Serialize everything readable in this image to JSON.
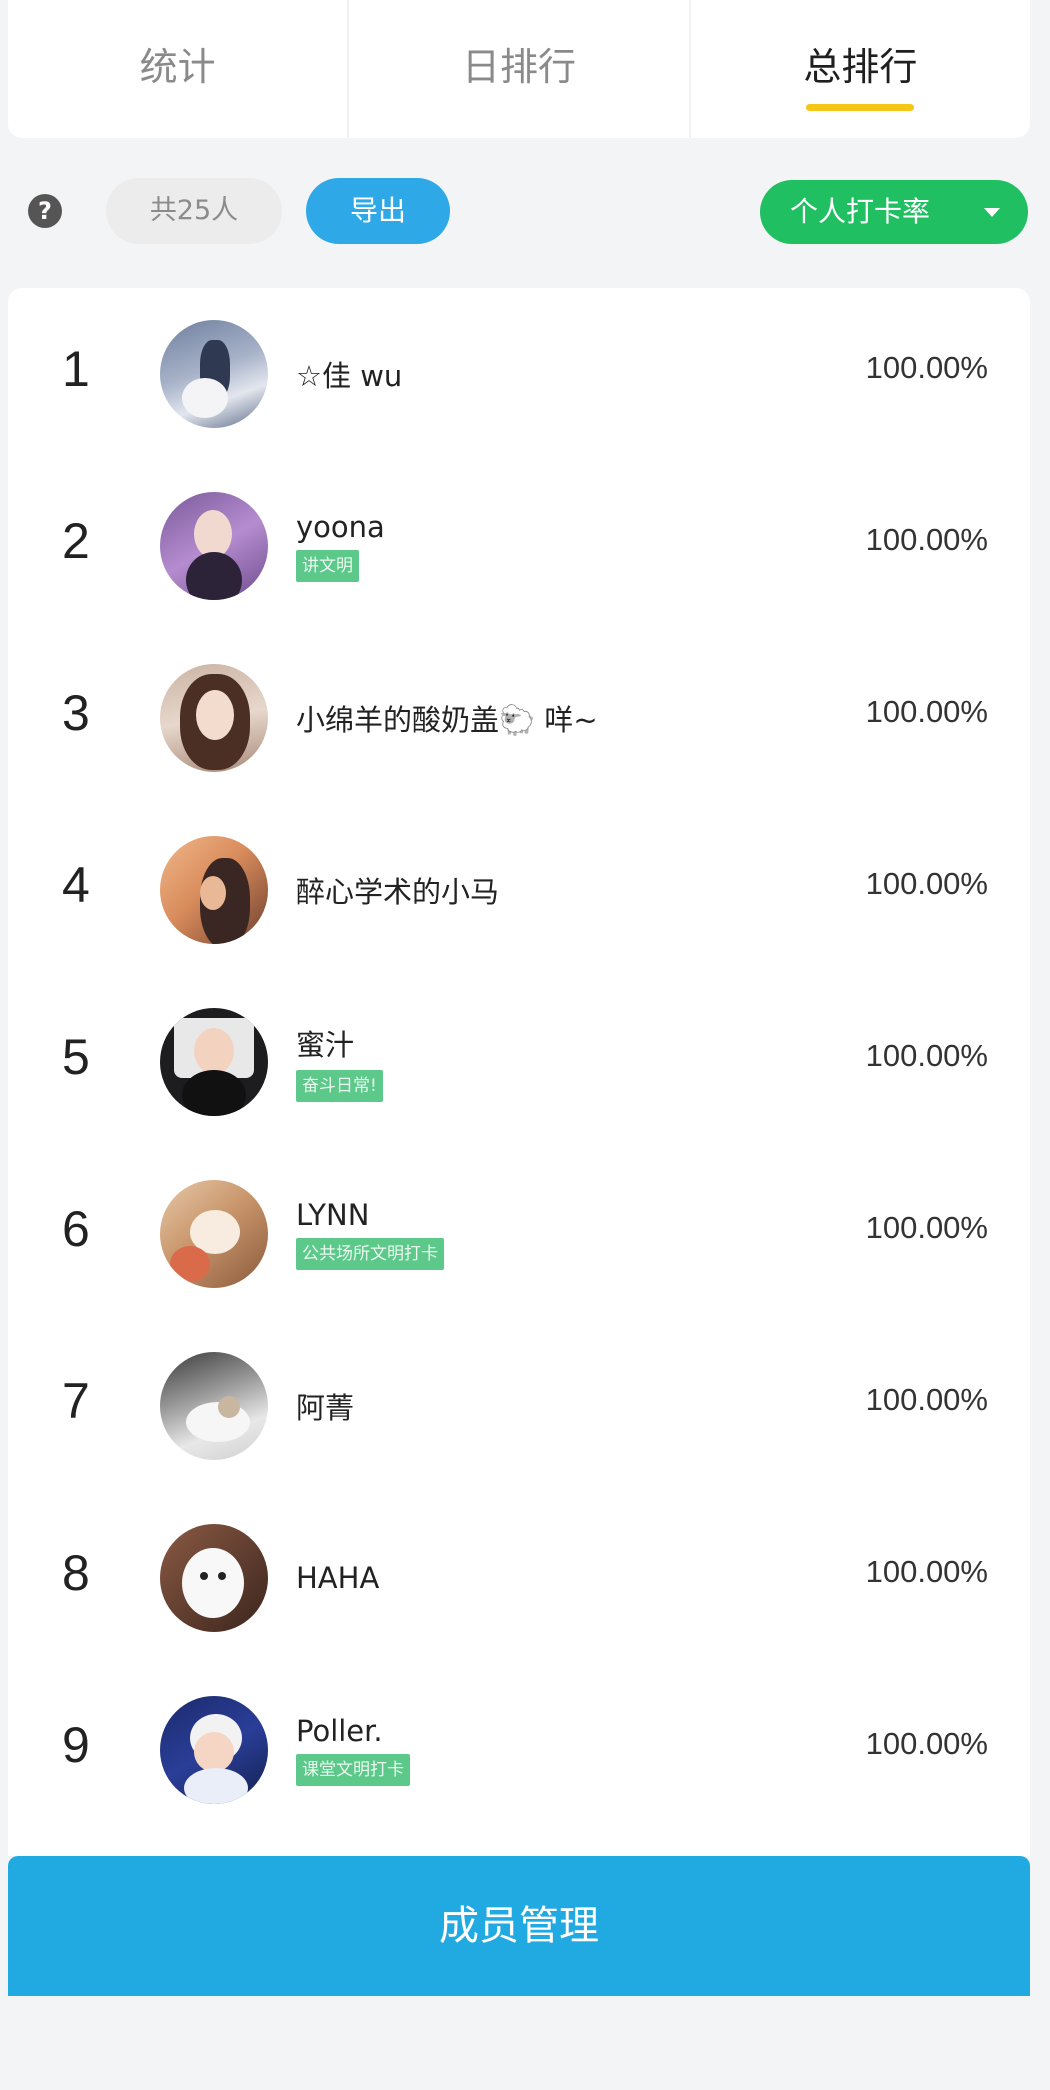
{
  "tabs": [
    {
      "label": "统计",
      "active": false
    },
    {
      "label": "日排行",
      "active": false
    },
    {
      "label": "总排行",
      "active": true
    }
  ],
  "toolbar": {
    "help_icon": "question-circle-icon",
    "help_glyph": "?",
    "member_count_label": "共25人",
    "export_label": "导出",
    "sort_label": "个人打卡率"
  },
  "ranking": [
    {
      "rank": "1",
      "name": "☆佳 wu",
      "tag": "",
      "rate": "100.00%"
    },
    {
      "rank": "2",
      "name": "yoona",
      "tag": "讲文明",
      "rate": "100.00%"
    },
    {
      "rank": "3",
      "name": "小绵羊的酸奶盖🐑 咩~",
      "tag": "",
      "rate": "100.00%"
    },
    {
      "rank": "4",
      "name": "醉心学术的小马",
      "tag": "",
      "rate": "100.00%"
    },
    {
      "rank": "5",
      "name": "蜜汁",
      "tag": "奋斗日常!",
      "rate": "100.00%"
    },
    {
      "rank": "6",
      "name": "LYNN",
      "tag": "公共场所文明打卡",
      "rate": "100.00%"
    },
    {
      "rank": "7",
      "name": "阿菁",
      "tag": "",
      "rate": "100.00%"
    },
    {
      "rank": "8",
      "name": "HAHA",
      "tag": "",
      "rate": "100.00%"
    },
    {
      "rank": "9",
      "name": "Poller.",
      "tag": "课堂文明打卡",
      "rate": "100.00%"
    }
  ],
  "footer": {
    "manage_label": "成员管理"
  },
  "colors": {
    "accent_underline": "#f5c518",
    "export_button": "#2ea8e6",
    "sort_dropdown": "#1fbf62",
    "tag_badge": "#5cc98a",
    "manage_button": "#21a9e1"
  }
}
